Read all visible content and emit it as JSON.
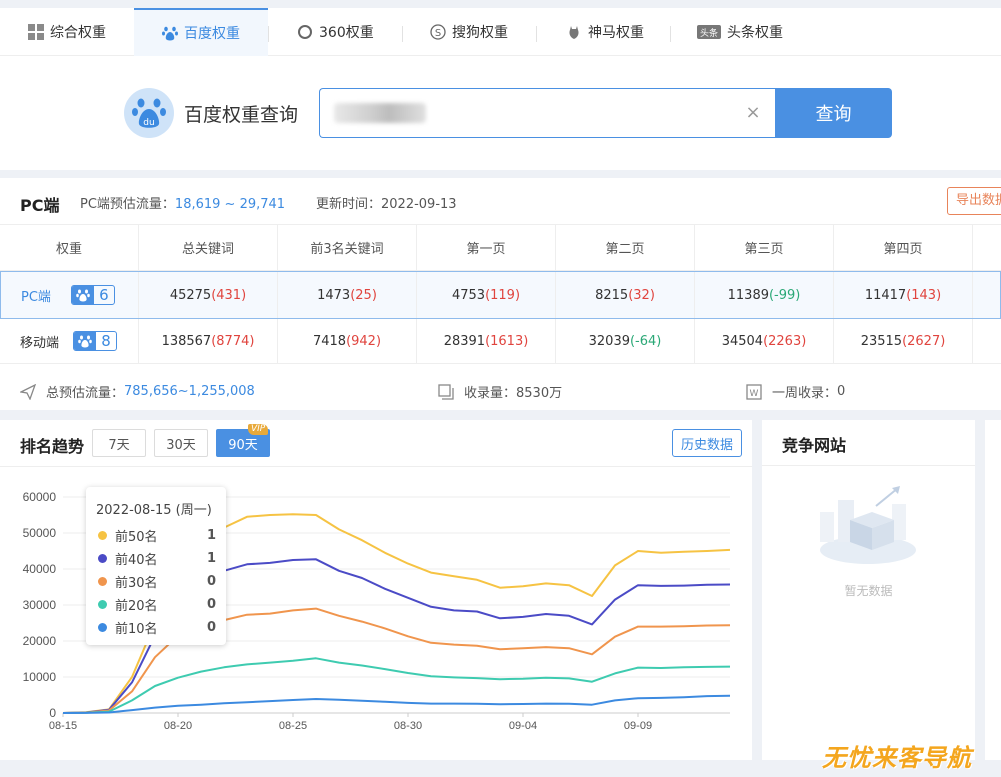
{
  "tabs": [
    {
      "label": "综合权重",
      "icon": "grid-icon"
    },
    {
      "label": "百度权重",
      "icon": "baidu-paw-icon",
      "active": true
    },
    {
      "label": "360权重",
      "icon": "360-icon"
    },
    {
      "label": "搜狗权重",
      "icon": "sogou-icon"
    },
    {
      "label": "神马权重",
      "icon": "shenma-icon"
    },
    {
      "label": "头条权重",
      "icon": "toutiao-icon"
    }
  ],
  "search": {
    "brand_title": "百度权重查询",
    "button_label": "查询",
    "clear_label": "×"
  },
  "stats": {
    "title": "PC端",
    "traffic_label": "PC端预估流量：",
    "traffic_value": "18,619 ~ 29,741",
    "update_label": "更新时间：2022-09-13",
    "export_label": "导出数据",
    "columns": [
      "权重",
      "总关键词",
      "前3名关键词",
      "第一页",
      "第二页",
      "第三页",
      "第四页"
    ],
    "rows": [
      {
        "label": "PC端",
        "weight": "6",
        "cells": [
          {
            "value": "45275",
            "delta": "(431)",
            "tone": "red"
          },
          {
            "value": "1473",
            "delta": "(25)",
            "tone": "red"
          },
          {
            "value": "4753",
            "delta": "(119)",
            "tone": "red"
          },
          {
            "value": "8215",
            "delta": "(32)",
            "tone": "red"
          },
          {
            "value": "11389",
            "delta": "(-99)",
            "tone": "green"
          },
          {
            "value": "11417",
            "delta": "(143)",
            "tone": "red"
          }
        ]
      },
      {
        "label": "移动端",
        "weight": "8",
        "cells": [
          {
            "value": "138567",
            "delta": "(8774)",
            "tone": "red"
          },
          {
            "value": "7418",
            "delta": "(942)",
            "tone": "red"
          },
          {
            "value": "28391",
            "delta": "(1613)",
            "tone": "red"
          },
          {
            "value": "32039",
            "delta": "(-64)",
            "tone": "green"
          },
          {
            "value": "34504",
            "delta": "(2263)",
            "tone": "red"
          },
          {
            "value": "23515",
            "delta": "(2627)",
            "tone": "red"
          }
        ]
      }
    ],
    "footer": {
      "total_traffic_label": "总预估流量：",
      "total_traffic_value": "785,656~1,255,008",
      "indexed_label": "收录量：",
      "indexed_value": "8530万",
      "weekly_label": "一周收录：",
      "weekly_value": "0"
    }
  },
  "trend": {
    "title": "排名趋势",
    "ranges": [
      "7天",
      "30天",
      "90天"
    ],
    "active_range": "90天",
    "vip_label": "VIP",
    "history_label": "历史数据",
    "tooltip": {
      "date": "2022-08-15 (周一)",
      "items": [
        {
          "name": "前50名",
          "value": "1",
          "color": "#f6c343"
        },
        {
          "name": "前40名",
          "value": "1",
          "color": "#4b4bc6"
        },
        {
          "name": "前30名",
          "value": "0",
          "color": "#f0954d"
        },
        {
          "name": "前20名",
          "value": "0",
          "color": "#3ecbb0"
        },
        {
          "name": "前10名",
          "value": "0",
          "color": "#3c8ae0"
        }
      ]
    }
  },
  "chart_data": {
    "type": "line",
    "x": [
      "08-15",
      "08-16",
      "08-17",
      "08-18",
      "08-19",
      "08-20",
      "08-21",
      "08-22",
      "08-23",
      "08-24",
      "08-25",
      "08-26",
      "08-27",
      "08-28",
      "08-29",
      "08-30",
      "08-31",
      "09-01",
      "09-02",
      "09-03",
      "09-04",
      "09-05",
      "09-06",
      "09-07",
      "09-08",
      "09-09",
      "09-10",
      "09-11",
      "09-12",
      "09-13"
    ],
    "x_ticks": [
      "08-15",
      "08-20",
      "08-25",
      "08-30",
      "09-04",
      "09-09"
    ],
    "ylim": [
      0,
      60000
    ],
    "y_ticks": [
      0,
      10000,
      20000,
      30000,
      40000,
      50000,
      60000
    ],
    "series": [
      {
        "name": "前50名",
        "color": "#f6c343",
        "values": [
          1,
          200,
          1000,
          10000,
          25000,
          38000,
          47000,
          51500,
          54500,
          55000,
          55200,
          55000,
          51000,
          48000,
          44500,
          41500,
          39000,
          38000,
          37000,
          34800,
          35200,
          36000,
          35500,
          32500,
          41000,
          45000,
          44500,
          44800,
          45000,
          45300
        ]
      },
      {
        "name": "前40名",
        "color": "#4b4bc6",
        "values": [
          1,
          150,
          900,
          8500,
          21500,
          32000,
          37000,
          39500,
          41300,
          41700,
          42500,
          42700,
          39500,
          37500,
          34500,
          32000,
          29500,
          28500,
          28200,
          26300,
          26700,
          27500,
          27000,
          24600,
          31500,
          35500,
          35300,
          35400,
          35600,
          35700
        ]
      },
      {
        "name": "前30名",
        "color": "#f0954d",
        "values": [
          0,
          100,
          700,
          6000,
          15500,
          21500,
          24500,
          25800,
          27300,
          27600,
          28500,
          29000,
          27000,
          25400,
          23500,
          21300,
          19500,
          19000,
          18700,
          17700,
          18000,
          18300,
          18000,
          16300,
          21200,
          24000,
          24000,
          24100,
          24300,
          24400
        ]
      },
      {
        "name": "前20名",
        "color": "#3ecbb0",
        "values": [
          0,
          50,
          400,
          3500,
          7500,
          9800,
          11500,
          12700,
          13500,
          14000,
          14500,
          15200,
          14000,
          13200,
          12200,
          11100,
          10200,
          9900,
          9700,
          9400,
          9500,
          9800,
          9600,
          8700,
          11000,
          12600,
          12500,
          12700,
          12800,
          12900
        ]
      },
      {
        "name": "前10名",
        "color": "#3c8ae0",
        "values": [
          0,
          20,
          150,
          800,
          1500,
          2000,
          2300,
          2700,
          3000,
          3300,
          3600,
          3900,
          3700,
          3400,
          3100,
          2800,
          2600,
          2600,
          2550,
          2450,
          2500,
          2600,
          2550,
          2300,
          3500,
          4100,
          4200,
          4400,
          4700,
          4800
        ]
      }
    ]
  },
  "competitor": {
    "title": "竞争网站",
    "empty_text": "暂无数据"
  },
  "watermark": "无忧来客导航"
}
